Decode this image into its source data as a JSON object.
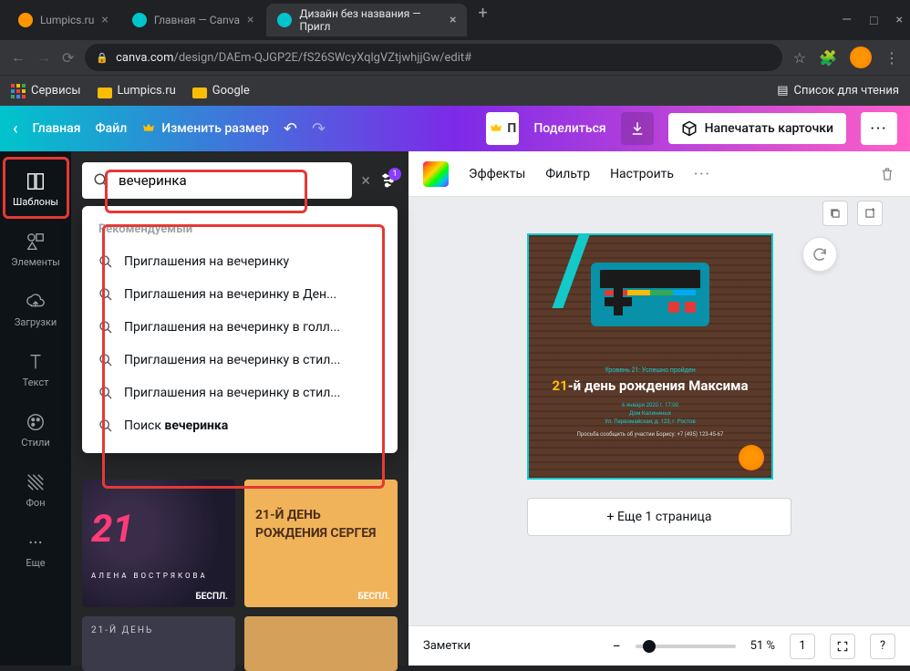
{
  "browser": {
    "tabs": [
      {
        "title": "Lumpics.ru",
        "favicon": "#ff9500"
      },
      {
        "title": "Главная — Canva",
        "favicon": "#00c4cc"
      },
      {
        "title": "Дизайн без названия — Пригл",
        "favicon": "#00c4cc"
      }
    ],
    "url_domain": "canva.com",
    "url_path": "/design/DAEm-QJGP2E/fS26SWcyXqlgVZtjwhjjGw/edit#",
    "bookmarks": {
      "services": "Сервисы",
      "lumpics": "Lumpics.ru",
      "google": "Google",
      "reading_list": "Список для чтения"
    }
  },
  "canva_toolbar": {
    "home": "Главная",
    "file": "Файл",
    "resize": "Изменить размер",
    "share": "Поделиться",
    "print": "Напечатать карточки"
  },
  "sidebar": {
    "templates": "Шаблоны",
    "elements": "Элементы",
    "uploads": "Загрузки",
    "text": "Текст",
    "styles": "Стили",
    "background": "Фон",
    "more": "Еще"
  },
  "search": {
    "value": "вечеринка",
    "filter_badge": "1",
    "header": "Рекомендуемый",
    "suggestions": [
      "Приглашения на вечеринку",
      "Приглашения на вечеринку в Ден...",
      "Приглашения на вечеринку в голл...",
      "Приглашения на вечеринку в стил...",
      "Приглашения на вечеринку в стил..."
    ],
    "search_for_prefix": "Поиск ",
    "search_for_term": "вечеринка"
  },
  "templates": {
    "t1_number": "21",
    "t1_name": "АЛЕНА ВОСТРЯКОВА",
    "t2_text": "21-Й ДЕНЬ РОЖДЕНИЯ СЕРГЕЯ",
    "t3_text": "21-Й ДЕНЬ",
    "free_label": "БЕСПЛ."
  },
  "canvas": {
    "toolbar": {
      "effects": "Эффекты",
      "filter": "Фильтр",
      "adjust": "Настроить"
    },
    "design": {
      "level": "Уровень 21: Успешно пройден",
      "title_num": "21",
      "title_rest": "-й день рождения Максима",
      "info": "6 января 2020 г. 17:00\nДом Калининых\nУл. Первомайская, д. 123, г. Ростов",
      "phone": "Просьба сообщить об участии Борису: +7 (495) 123-45-67"
    },
    "add_page": "+ Еще 1 страница",
    "notes": "Заметки",
    "zoom": "51 %",
    "page_indicator": "1"
  }
}
